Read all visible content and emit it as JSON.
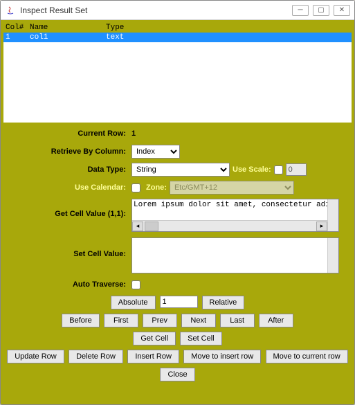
{
  "window": {
    "title": "Inspect Result Set"
  },
  "table": {
    "headers": {
      "col": "Col#",
      "name": "Name",
      "type": "Type"
    },
    "rows": [
      {
        "col": "1",
        "name": "col1",
        "type": "text"
      }
    ]
  },
  "form": {
    "current_row": {
      "label": "Current Row:",
      "value": "1"
    },
    "retrieve_by": {
      "label": "Retrieve By Column:",
      "value": "Index"
    },
    "data_type": {
      "label": "Data Type:",
      "value": "String",
      "use_scale_label": "Use Scale:",
      "scale_value": "0"
    },
    "calendar": {
      "label": "Use Calendar:",
      "zone_label": "Zone:",
      "zone_value": "Etc/GMT+12"
    },
    "get_cell": {
      "label": "Get Cell Value (1,1):",
      "value": "Lorem ipsum dolor sit amet, consectetur adipisicing e"
    },
    "set_cell": {
      "label": "Set Cell Value:",
      "value": ""
    },
    "auto_traverse": {
      "label": "Auto Traverse:"
    },
    "absolute_value": "1"
  },
  "buttons": {
    "absolute": "Absolute",
    "relative": "Relative",
    "before": "Before",
    "first": "First",
    "prev": "Prev",
    "next": "Next",
    "last": "Last",
    "after": "After",
    "get_cell": "Get Cell",
    "set_cell": "Set Cell",
    "update_row": "Update Row",
    "delete_row": "Delete Row",
    "insert_row": "Insert Row",
    "move_insert": "Move to insert row",
    "move_current": "Move to current row",
    "close": "Close"
  }
}
